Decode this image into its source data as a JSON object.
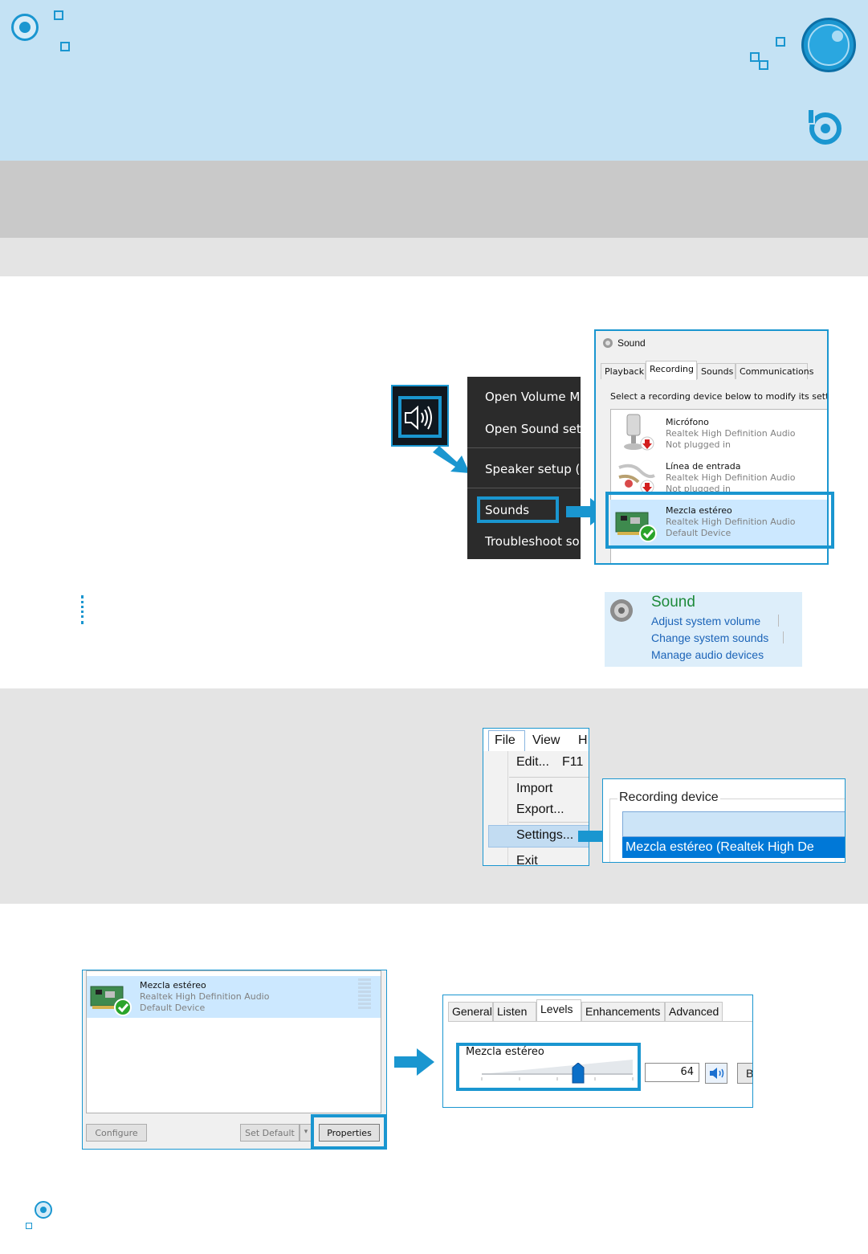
{
  "banner": {
    "decor": [
      "ring-icon",
      "square-icon",
      "logo-icon",
      "refresh-icon"
    ]
  },
  "sound_dialog": {
    "title": "Sound",
    "tabs": [
      "Playback",
      "Recording",
      "Sounds",
      "Communications"
    ],
    "active_tab": "Recording",
    "description": "Select a recording device below to modify its settin",
    "devices": [
      {
        "name": "Micrófono",
        "driver": "Realtek High Definition Audio",
        "status": "Not plugged in"
      },
      {
        "name": "Línea de entrada",
        "driver": "Realtek High Definition Audio",
        "status": "Not plugged in"
      },
      {
        "name": "Mezcla estéreo",
        "driver": "Realtek High Definition Audio",
        "status": "Default Device"
      }
    ]
  },
  "context_menu": {
    "items": [
      "Open Volume Mix",
      "Open Sound settin",
      "Speaker setup (Ste",
      "Sounds",
      "Troubleshoot sou"
    ]
  },
  "control_panel": {
    "title": "Sound",
    "links": [
      "Adjust system volume",
      "Change system sounds",
      "Manage audio devices"
    ]
  },
  "file_menu": {
    "menubar": [
      "File",
      "View",
      "H"
    ],
    "items": [
      {
        "label": "Edit...",
        "shortcut": "F11"
      },
      {
        "label": "Import",
        "shortcut": ""
      },
      {
        "label": "Export...",
        "shortcut": ""
      },
      {
        "label": "Settings...",
        "shortcut": ""
      },
      {
        "label": "Exit",
        "shortcut": ""
      }
    ]
  },
  "recording_device": {
    "legend": "Recording device",
    "selected_value": "",
    "option": "Mezcla estéreo (Realtek High De"
  },
  "device_list": {
    "device": {
      "name": "Mezcla estéreo",
      "driver": "Realtek High Definition Audio",
      "status": "Default Device"
    },
    "buttons": {
      "configure": "Configure",
      "set_default": "Set Default",
      "properties": "Properties"
    }
  },
  "levels": {
    "tabs": [
      "General",
      "Listen",
      "Levels",
      "Enhancements",
      "Advanced"
    ],
    "active_tab": "Levels",
    "label": "Mezcla estéreo",
    "value": "64",
    "level_fraction": 0.64,
    "balance_label": "B"
  },
  "colors": {
    "accent": "#1a96d0",
    "banner": "#c4e2f4",
    "selection": "#cce8ff",
    "link": "#1c64b8",
    "cp_title": "#1e8a3a"
  }
}
